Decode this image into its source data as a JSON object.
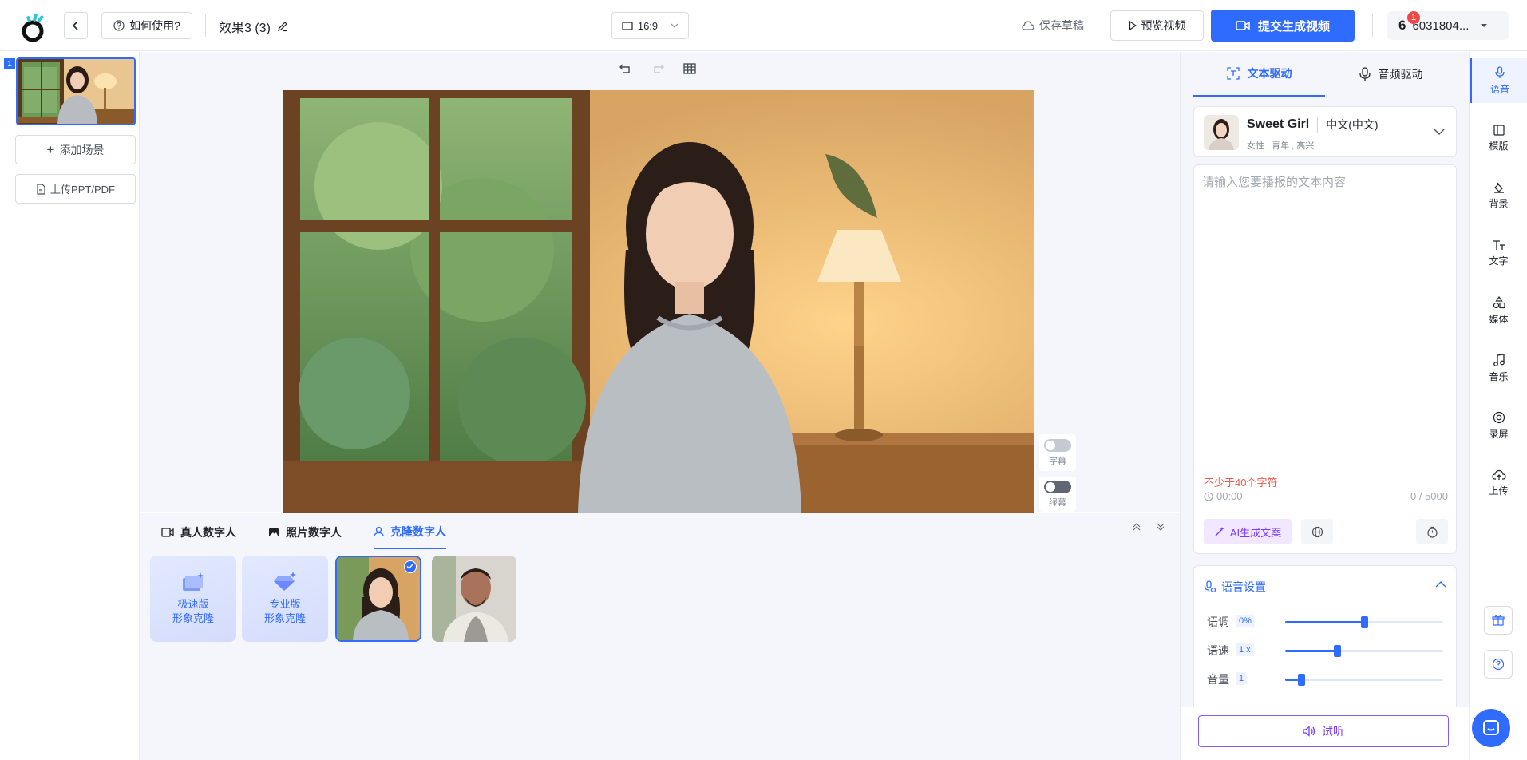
{
  "header": {
    "help_label": "如何使用?",
    "project_title": "效果3 (3)",
    "aspect_ratio": "16:9",
    "save_draft_label": "保存草稿",
    "preview_label": "预览视频",
    "submit_label": "提交生成视频",
    "notification_count": "1",
    "user_initial": "6",
    "user_id": "6031804..."
  },
  "scenes": {
    "items": [
      {
        "index": "1"
      }
    ],
    "add_scene_label": "添加场景",
    "upload_label": "上传PPT/PDF"
  },
  "canvas": {
    "toggles": [
      {
        "label": "字幕"
      },
      {
        "label": "绿幕"
      }
    ]
  },
  "avatars": {
    "tabs": [
      {
        "label": "真人数字人"
      },
      {
        "label": "照片数字人"
      },
      {
        "label": "克隆数字人"
      }
    ],
    "active_tab": "克隆数字人",
    "cards": [
      {
        "line1": "极速版",
        "line2": "形象克隆"
      },
      {
        "line1": "专业版",
        "line2": "形象克隆"
      }
    ]
  },
  "drive": {
    "tabs": [
      {
        "label": "文本驱动"
      },
      {
        "label": "音频驱动"
      }
    ],
    "active_tab": "文本驱动"
  },
  "voice": {
    "name": "Sweet Girl",
    "language": "中文(中文)",
    "tags": "女性 , 青年 , 高兴"
  },
  "script": {
    "placeholder": "请输入您要播报的文本内容",
    "min_chars_warning": "不少于40个字符",
    "duration": "00:00",
    "char_count": "0 / 5000",
    "ai_label": "AI生成文案"
  },
  "voice_settings": {
    "title": "语音设置",
    "sliders": [
      {
        "label": "语调",
        "value_text": "0%",
        "fraction": 0.5
      },
      {
        "label": "语速",
        "value_text": "1 x",
        "fraction": 0.33
      },
      {
        "label": "音量",
        "value_text": "1",
        "fraction": 0.1
      }
    ],
    "listen_label": "试听"
  },
  "toolbar": {
    "items": [
      {
        "label": "语音"
      },
      {
        "label": "模版"
      },
      {
        "label": "背景"
      },
      {
        "label": "文字"
      },
      {
        "label": "媒体"
      },
      {
        "label": "音乐"
      },
      {
        "label": "录屏"
      },
      {
        "label": "上传"
      }
    ],
    "active": "语音"
  },
  "colors": {
    "primary": "#2f6bff",
    "ai_purple": "#7b3cff",
    "warning": "#f05a4a"
  }
}
